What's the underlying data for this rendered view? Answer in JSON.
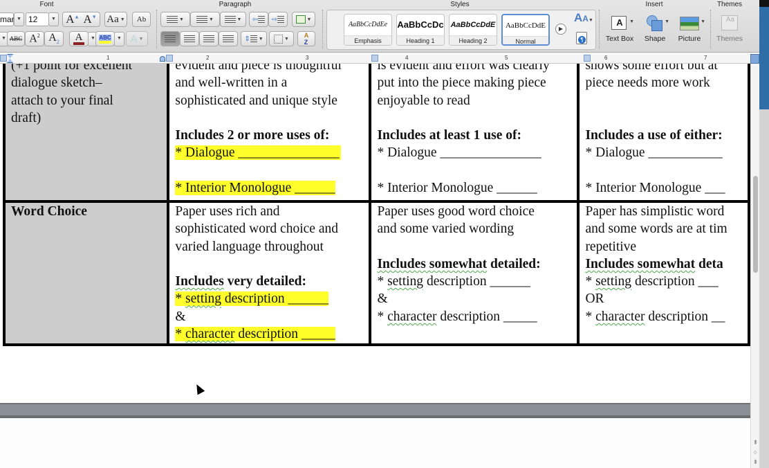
{
  "ribbon": {
    "groups": {
      "font": "Font",
      "paragraph": "Paragraph",
      "styles": "Styles",
      "insert": "Insert",
      "themes": "Themes"
    },
    "font": {
      "font_name_value": "man",
      "font_size_value": "12",
      "grow_label": "A",
      "shrink_label": "A",
      "change_case_label": "Aa",
      "clear_format_label": "Ab",
      "strikethrough_label": "ABC",
      "superscript_label": "A",
      "subscript_label": "A",
      "font_color_label": "A",
      "highlight_label": "ABC",
      "text_effects_label": "A",
      "colors": {
        "font_color_bar": "#8b2020",
        "highlight_bar": "#ffff2b"
      }
    },
    "styles": [
      {
        "sample": "AaBbCcDdEe",
        "label": "Emphasis",
        "selected": false
      },
      {
        "sample": "AaBbCcDc",
        "label": "Heading 1",
        "selected": false
      },
      {
        "sample": "AaBbCcDdE",
        "label": "Heading 2",
        "selected": false
      },
      {
        "sample": "AaBbCcDdE",
        "label": "Normal",
        "selected": true
      }
    ],
    "insert": [
      {
        "label": "Text Box",
        "icon": "text-box-icon"
      },
      {
        "label": "Shape",
        "icon": "shape-icon"
      },
      {
        "label": "Picture",
        "icon": "picture-icon"
      }
    ],
    "themes": {
      "label": "Themes",
      "icon": "themes-icon"
    }
  },
  "ruler": {
    "numbers": [
      "1",
      "2",
      "3",
      "4",
      "5",
      "6",
      "7"
    ]
  },
  "rubric": {
    "rows": [
      {
        "category": [
          "(+1 point for excellent",
          "dialogue sketch–",
          "attach to your final",
          "draft)"
        ],
        "col1": {
          "text": [
            "evident and piece is thoughtful",
            "and well-written in a",
            "sophisticated and unique style"
          ],
          "heading": "Includes 2 or more uses of:",
          "items": [
            "* Dialogue  _______________",
            "* Interior Monologue ______"
          ]
        },
        "col2": {
          "text": [
            "is evident and effort was clearly",
            "put into the piece making piece",
            "enjoyable to read"
          ],
          "heading": "Includes at least 1 use of:",
          "items": [
            "* Dialogue  _______________",
            "* Interior Monologue ______"
          ]
        },
        "col3": {
          "text": [
            "shows some effort but at",
            "piece needs more work"
          ],
          "heading": "Includes a use of either:",
          "items": [
            "* Dialogue  ___________",
            "* Interior Monologue ___"
          ]
        }
      },
      {
        "category": [
          "Word Choice"
        ],
        "col1": {
          "text": [
            "Paper uses rich and",
            "sophisticated word choice and",
            "varied language throughout"
          ],
          "heading_pre": "Includes",
          "heading_rest": "  very detailed:",
          "item1_word": "setting",
          "item1_rest": " description  ______",
          "joiner": "&",
          "item2_word": "character",
          "item2_rest": " description _____"
        },
        "col2": {
          "text": [
            "Paper uses good word choice",
            "and some varied wording"
          ],
          "heading_pre": "Includes  somewhat",
          "heading_rest": " detailed:",
          "item1_word": "setting",
          "item1_rest": " description  ______",
          "joiner": "&",
          "item2_word": "character",
          "item2_rest": " description _____"
        },
        "col3": {
          "text": [
            "Paper has simplistic word",
            "and some words are at tim",
            "repetitive"
          ],
          "heading_pre": "Includes  somewhat",
          "heading_rest": " deta",
          "item1_word": "setting",
          "item1_rest": " description  ___",
          "joiner": "OR",
          "item2_word": "character",
          "item2_rest": " description __"
        }
      }
    ]
  },
  "colors": {
    "highlight": "#ffff2b",
    "category_bg": "#cdcdcd",
    "accent": "#5b8ed6"
  }
}
